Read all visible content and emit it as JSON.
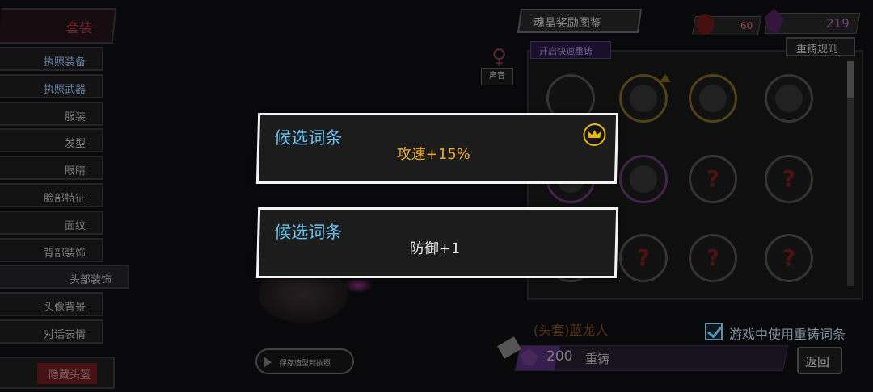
{
  "left_menu": {
    "title": "套装",
    "items": [
      {
        "label": "执照装备",
        "active": true
      },
      {
        "label": "执照武器",
        "active": true
      },
      {
        "label": "服装",
        "active": false
      },
      {
        "label": "发型",
        "active": false
      },
      {
        "label": "眼睛",
        "active": false
      },
      {
        "label": "脸部特征",
        "active": false
      },
      {
        "label": "面纹",
        "active": false
      },
      {
        "label": "背部装饰",
        "active": false
      },
      {
        "label": "头部装饰",
        "active": false
      },
      {
        "label": "头像背景",
        "active": false
      },
      {
        "label": "对话表情",
        "active": false
      }
    ],
    "hide_head_label": "隐藏头盔"
  },
  "scene": {
    "sound_label": "声音",
    "save_label": "保存造型到执照"
  },
  "right_panel": {
    "title": "魂晶奖励图鉴",
    "currency_red": "60",
    "currency_purple": "219",
    "quick_reforge_label": "开启快速重铸",
    "rules_label": "重铸规则",
    "item_name": "(头套)蓝龙人",
    "ingame_reforge_label": "游戏中使用重铸词条",
    "ingame_reforge_checked": true,
    "reforge_cost": "200",
    "reforge_label": "重铸",
    "back_label": "返回",
    "slots": [
      {
        "state": "empty"
      },
      {
        "state": "owned-gold"
      },
      {
        "state": "owned-gold"
      },
      {
        "state": "owned"
      },
      {
        "state": "owned-purple"
      },
      {
        "state": "owned-purple"
      },
      {
        "state": "unknown"
      },
      {
        "state": "unknown"
      },
      {
        "state": "unknown"
      },
      {
        "state": "unknown"
      },
      {
        "state": "unknown"
      },
      {
        "state": "unknown"
      }
    ]
  },
  "cards": [
    {
      "title": "候选词条",
      "value": "攻速+15%",
      "value_color": "#f2ab1a",
      "crown": true,
      "crown_icon": "crown-icon"
    },
    {
      "title": "候选词条",
      "value": "防御+1",
      "value_color": "#e6e6e6",
      "crown": false
    }
  ],
  "colors": {
    "card_title": "#67c3ee",
    "crown_gold": "#e8b800"
  }
}
